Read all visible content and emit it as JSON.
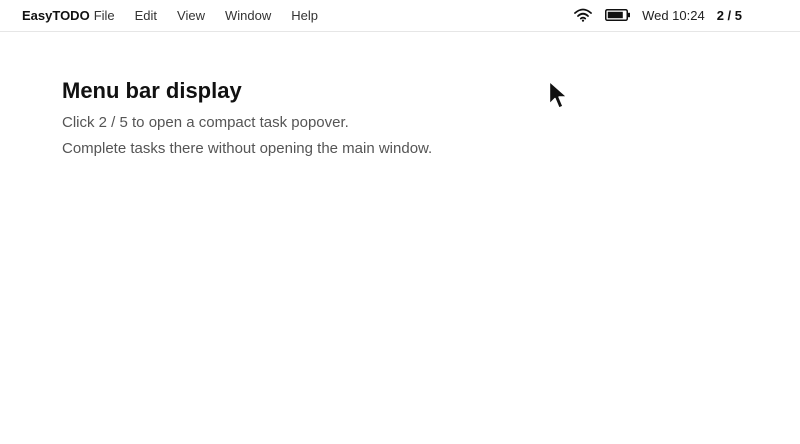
{
  "menubar": {
    "app_name": "EasyTODO",
    "menus": [
      "File",
      "Edit",
      "View",
      "Window",
      "Help"
    ],
    "status": {
      "wifi_icon": "wifi-icon",
      "battery_icon": "battery-icon",
      "clock": "Wed 10:24",
      "task_count": "2 / 5"
    }
  },
  "main": {
    "title": "Menu bar display",
    "lines": [
      "Click 2 / 5 to open a compact task popover.",
      "Complete tasks there without opening the main window."
    ]
  },
  "colors": {
    "text_primary": "#111111",
    "text_secondary": "#555555",
    "divider": "#e6e6e6"
  }
}
